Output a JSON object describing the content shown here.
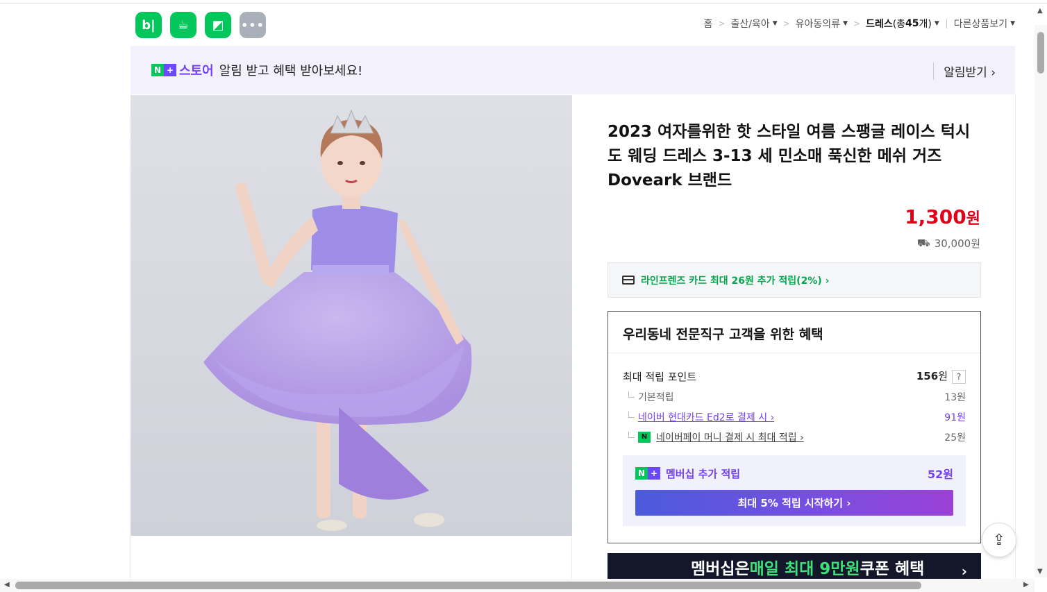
{
  "apps": [
    {
      "name": "blog",
      "glyph": "b|"
    },
    {
      "name": "cafe",
      "glyph": "☕"
    },
    {
      "name": "bookmark",
      "glyph": "◩"
    },
    {
      "name": "more",
      "glyph": "•••"
    }
  ],
  "breadcrumb": {
    "home": "홈",
    "cat1": "출산/육아",
    "cat2": "유아동의류",
    "current": "드레스",
    "count_prefix": "(총 ",
    "count": "45",
    "count_suffix": "개)",
    "other": "다른상품보기"
  },
  "banner": {
    "brand": "스토어",
    "message": "알림 받고 혜택 받아보세요!",
    "alarm": "알림받기 ›"
  },
  "product": {
    "title": "2023 여자를위한 핫 스타일 여름 스팽글 레이스 턱시도 웨딩 드레스 3-13 세 민소매 푹신한 메쉬 거즈 Doveark 브랜드",
    "price_number": "1,300",
    "price_unit": "원",
    "shipping": "30,000원"
  },
  "card_offer": "라인프렌즈 카드 최대 26원 추가 적립(2%) ›",
  "benefit": {
    "heading": "우리동네 전문직구 고객을 위한 혜택",
    "max_points_label": "최대 적립 포인트",
    "max_points_value": "156",
    "unit": "원",
    "help": "?",
    "basic_label": "기본적립",
    "basic_value": "13원",
    "card_label": "네이버 현대카드 Ed2로 결제 시 ›",
    "card_value": "91원",
    "npay_label": "네이버페이 머니 결제 시 최대 적립 ›",
    "npay_value": "25원",
    "membership_label": "멤버십 추가 적립",
    "membership_value": "52원",
    "membership_button": "최대 5% 적립 시작하기 ›"
  },
  "promo": {
    "prefix": "멤버십은 ",
    "highlight": "매일 최대 9만원",
    "suffix": " 쿠폰 혜택"
  },
  "colors": {
    "price": "#e0001a",
    "naver_green": "#03c75a",
    "membership_purple": "#7340f5"
  }
}
